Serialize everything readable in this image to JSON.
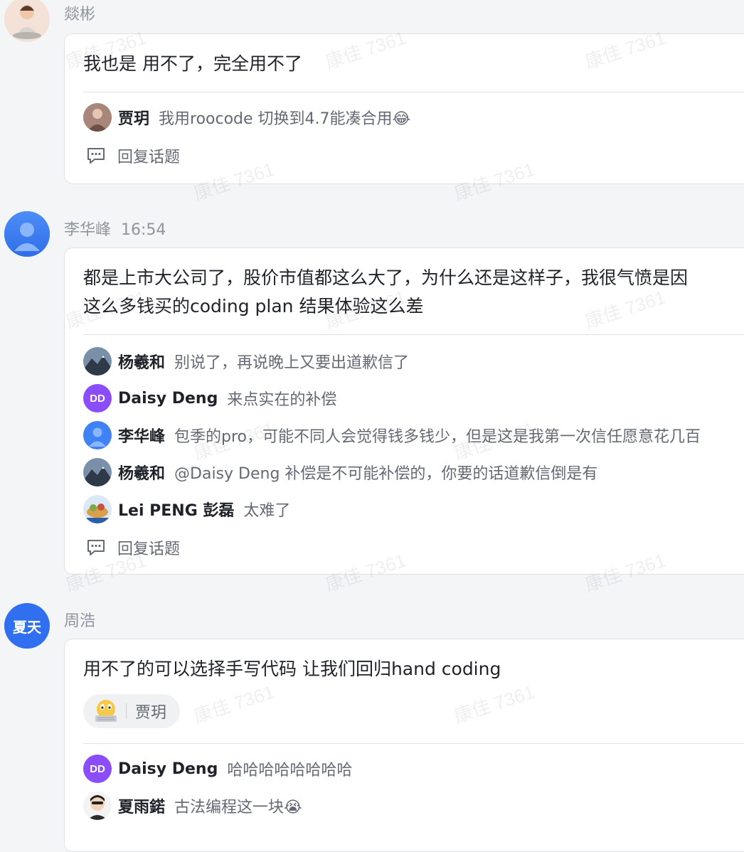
{
  "watermark": "康佳 7361",
  "messages": [
    {
      "sender": "燚彬",
      "body": [
        "我也是 用不了，完全用不了"
      ],
      "replies": [
        {
          "name": "贾玥",
          "text": "我用roocode 切换到4.7能凑合用😂"
        }
      ],
      "reply_topic": "回复话题"
    },
    {
      "sender": "李华峰",
      "time": "16:54",
      "body": [
        "都是上市大公司了，股价市值都这么大了，为什么还是这样子，我很气愤是因",
        "这么多钱买的coding plan 结果体验这么差"
      ],
      "replies": [
        {
          "name": "杨羲和",
          "text": "别说了，再说晚上又要出道歉信了"
        },
        {
          "name": "Daisy Deng",
          "avatar_text": "DD",
          "text": "来点实在的补偿"
        },
        {
          "name": "李华峰",
          "text": "包季的pro，可能不同人会觉得钱多钱少，但是这是我第一次信任愿意花几百"
        },
        {
          "name": "杨羲和",
          "text": "@Daisy Deng 补偿是不可能补偿的，你要的话道歉信倒是有"
        },
        {
          "name": "Lei PENG 彭磊",
          "text": "太难了"
        }
      ],
      "reply_topic": "回复话题"
    },
    {
      "sender": "周浩",
      "avatar_text": "夏天",
      "body": [
        "用不了的可以选择手写代码 让我们回归hand coding"
      ],
      "reaction": {
        "emoji": "typing-face-icon",
        "by": "贾玥"
      },
      "replies": [
        {
          "name": "Daisy Deng",
          "avatar_text": "DD",
          "text": "哈哈哈哈哈哈哈哈"
        },
        {
          "name": "夏雨鍩",
          "text": "古法编程这一块😭"
        }
      ]
    }
  ]
}
